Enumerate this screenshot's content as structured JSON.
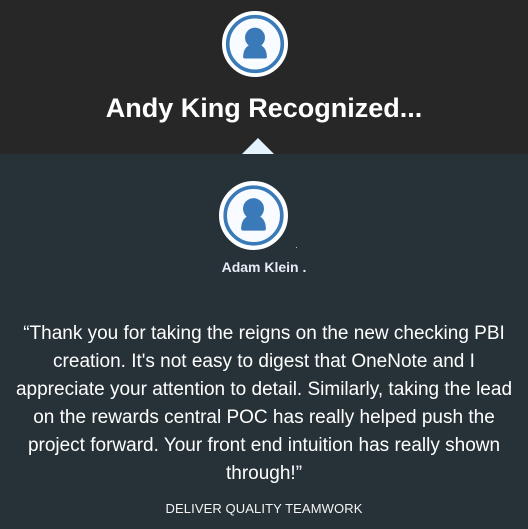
{
  "recognition": {
    "title": "Andy King Recognized...",
    "recipient_mark": "·",
    "sender_name": "Adam Klein .",
    "message_lines": [
      "“Thank you for taking the reigns on the new checking PBI",
      "creation. It's not easy to digest that OneNote and I",
      "appreciate your attention to detail. Similarly, taking the lead",
      "on the rewards central POC has really helped push the",
      "project forward. Your front end intuition has really shown",
      "through!”"
    ],
    "values_line": "DELIVER QUALITY TEAMWORK"
  },
  "colors": {
    "header_background": "#272727",
    "panel_background": "#263238",
    "avatar_accent": "#3a7ab8",
    "pointer": "#e3f2fd"
  },
  "icons": {
    "recognizer_avatar": "person-avatar-icon",
    "recipient_avatar": "person-avatar-icon"
  }
}
